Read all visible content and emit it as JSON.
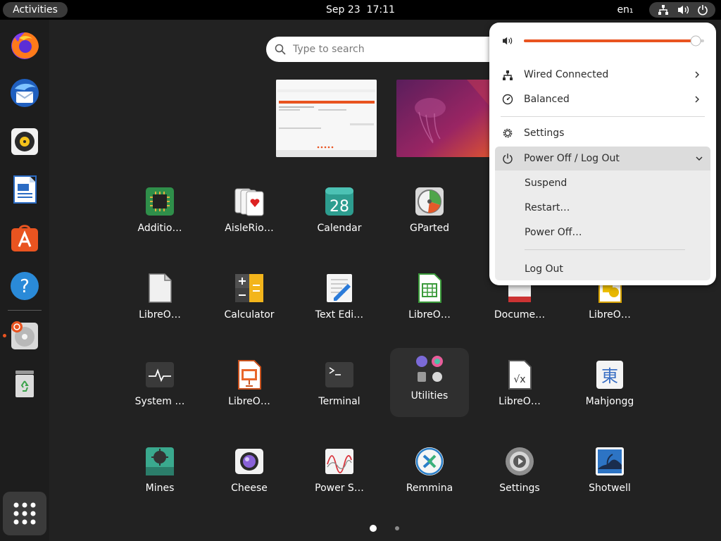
{
  "topbar": {
    "activities_label": "Activities",
    "date": "Sep 23",
    "time": "17:11",
    "input_source": "en₁",
    "indicators": [
      "network-icon",
      "volume-icon",
      "power-icon"
    ]
  },
  "dock": {
    "items": [
      {
        "name": "Firefox",
        "icon": "firefox-icon"
      },
      {
        "name": "Thunderbird",
        "icon": "thunderbird-icon"
      },
      {
        "name": "Rhythmbox",
        "icon": "rhythmbox-icon"
      },
      {
        "name": "LibreOffice Writer",
        "icon": "libreoffice-writer-icon"
      },
      {
        "name": "Ubuntu Software",
        "icon": "software-store-icon"
      },
      {
        "name": "Help",
        "icon": "help-icon"
      },
      {
        "name": "Installer",
        "icon": "installer-icon"
      },
      {
        "name": "Trash",
        "icon": "trash-icon"
      }
    ],
    "show_apps_icon": "app-grid-icon"
  },
  "search": {
    "placeholder": "Type to search"
  },
  "apps": [
    {
      "label": "Additio…",
      "icon": "chip-icon"
    },
    {
      "label": "AisleRio…",
      "icon": "cards-icon"
    },
    {
      "label": "Calendar",
      "icon": "calendar-icon",
      "badge": "28"
    },
    {
      "label": "GParted",
      "icon": "disk-icon"
    },
    {
      "label": "LibreO…",
      "icon": "libreoffice-icon"
    },
    {
      "label": "Calculator",
      "icon": "calculator-icon"
    },
    {
      "label": "Text Edi…",
      "icon": "text-editor-icon"
    },
    {
      "label": "LibreO…",
      "icon": "libreoffice-calc-icon"
    },
    {
      "label": "Docume…",
      "icon": "document-viewer-icon"
    },
    {
      "label": "LibreO…",
      "icon": "libreoffice-draw-icon"
    },
    {
      "label": "System …",
      "icon": "system-monitor-icon"
    },
    {
      "label": "LibreO…",
      "icon": "libreoffice-impress-icon"
    },
    {
      "label": "Terminal",
      "icon": "terminal-icon"
    },
    {
      "label": "Utilities",
      "icon": "folder-utilities-icon"
    },
    {
      "label": "LibreO…",
      "icon": "libreoffice-math-icon"
    },
    {
      "label": "Mahjongg",
      "icon": "mahjongg-icon",
      "glyph": "東"
    },
    {
      "label": "Mines",
      "icon": "mines-icon"
    },
    {
      "label": "Cheese",
      "icon": "camera-icon"
    },
    {
      "label": "Power S…",
      "icon": "power-statistics-icon"
    },
    {
      "label": "Remmina",
      "icon": "remmina-icon"
    },
    {
      "label": "Settings",
      "icon": "settings-icon"
    },
    {
      "label": "Shotwell",
      "icon": "shotwell-icon"
    }
  ],
  "pagination": {
    "pages": 2,
    "current": 1
  },
  "system_menu": {
    "volume": 0.98,
    "accent_color": "#e95420",
    "wired_label": "Wired Connected",
    "power_mode_label": "Balanced",
    "settings_label": "Settings",
    "power_header_label": "Power Off / Log Out",
    "power_items": {
      "suspend": "Suspend",
      "restart": "Restart…",
      "power_off": "Power Off…",
      "log_out": "Log Out"
    }
  }
}
